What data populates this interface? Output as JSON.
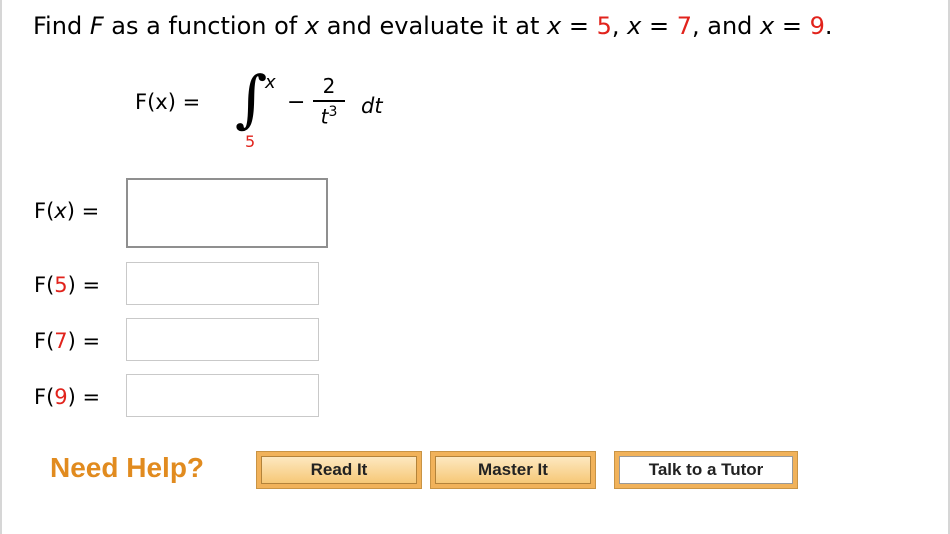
{
  "question": {
    "prefix": "Find ",
    "F": "F",
    "middle": " as a function of ",
    "x": "x",
    "middle2": " and evaluate it at ",
    "x1_label": "x = ",
    "x1_value": "5",
    "sep1": ",  ",
    "x2_label": "x = ",
    "x2_value": "7",
    "sep2": ", and ",
    "x3_label": "x = ",
    "x3_value": "9",
    "suffix": "."
  },
  "formula": {
    "lhs": "F(x)  =",
    "upper_limit": "x",
    "lower_limit": "5",
    "minus": "−",
    "numerator": "2",
    "denominator_base": "t",
    "denominator_exp": "3",
    "differential": "dt"
  },
  "answers": [
    {
      "label_prefix": "F(",
      "arg": "x",
      "label_suffix": ") =",
      "value": ""
    },
    {
      "label_prefix": "F(",
      "arg": "5",
      "label_suffix": ") =",
      "value": ""
    },
    {
      "label_prefix": "F(",
      "arg": "7",
      "label_suffix": ") =",
      "value": ""
    },
    {
      "label_prefix": "F(",
      "arg": "9",
      "label_suffix": ") =",
      "value": ""
    }
  ],
  "help": {
    "title": "Need Help?",
    "read_it": "Read It",
    "master_it": "Master It",
    "talk_tutor": "Talk to a Tutor"
  },
  "colors": {
    "highlight_red": "#e1231c",
    "help_orange": "#e18b1f",
    "button_orange": "#f1b25a"
  }
}
